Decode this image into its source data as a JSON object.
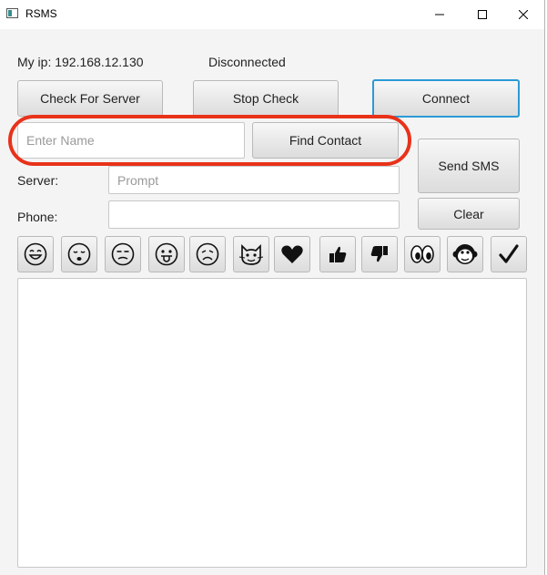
{
  "window": {
    "title": "RSMS"
  },
  "status": {
    "ip_text": "My ip: 192.168.12.130",
    "connection": "Disconnected"
  },
  "buttons": {
    "check_server": "Check For Server",
    "stop_check": "Stop Check",
    "connect": "Connect",
    "find_contact": "Find Contact",
    "send_sms": "Send SMS",
    "clear": "Clear"
  },
  "fields": {
    "name_placeholder": "Enter Name",
    "server_label": "Server:",
    "server_placeholder": "Prompt",
    "phone_label": "Phone:",
    "phone_value": ""
  },
  "emoji_bar": [
    "smile-icon",
    "kiss-icon",
    "unamused-icon",
    "tongue-icon",
    "sad-icon",
    "cat-icon",
    "heart-icon",
    "thumbs-up-icon",
    "thumbs-down-icon",
    "eyes-icon",
    "monkey-icon",
    "checkmark-icon"
  ],
  "message": {
    "text": ""
  },
  "colors": {
    "focus": "#2b9ad6",
    "annotation": "#e8321a"
  }
}
